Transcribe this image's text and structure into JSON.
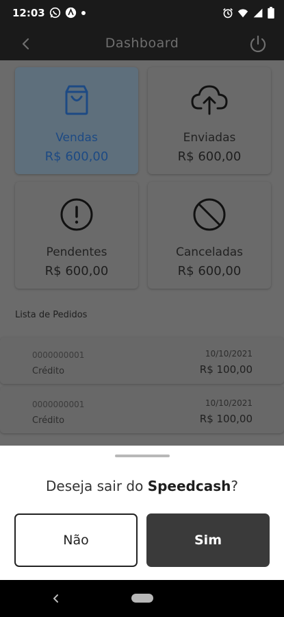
{
  "status_bar": {
    "time": "12:03",
    "left_icons": [
      "whatsapp-icon",
      "app-a-icon",
      "dot-icon"
    ],
    "right_icons": [
      "alarm-icon",
      "wifi-icon",
      "signal-icon",
      "battery-icon"
    ]
  },
  "app_bar": {
    "title": "Dashboard",
    "back_icon": "chevron-left-icon",
    "power_icon": "power-icon"
  },
  "cards": [
    {
      "label": "Vendas",
      "value": "R$ 600,00",
      "icon": "shopping-bag-icon",
      "active": true
    },
    {
      "label": "Enviadas",
      "value": "R$ 600,00",
      "icon": "cloud-upload-icon",
      "active": false
    },
    {
      "label": "Pendentes",
      "value": "R$ 600,00",
      "icon": "alert-circle-icon",
      "active": false
    },
    {
      "label": "Canceladas",
      "value": "R$ 600,00",
      "icon": "block-icon",
      "active": false
    }
  ],
  "orders": {
    "title": "Lista de Pedidos",
    "rows": [
      {
        "id": "0000000001",
        "type": "Crédito",
        "date": "10/10/2021",
        "amount": "R$ 100,00"
      },
      {
        "id": "0000000001",
        "type": "Crédito",
        "date": "10/10/2021",
        "amount": "R$ 100,00"
      }
    ]
  },
  "sheet": {
    "question_prefix": "Deseja sair do ",
    "brand": "Speedcash",
    "question_suffix": "?",
    "no_label": "Não",
    "yes_label": "Sim"
  },
  "colors": {
    "overlay_dim": "#6b6b6b",
    "active_card": "#5e6f7c",
    "active_text": "#1d4a84",
    "primary_button": "#3a3a3a"
  }
}
